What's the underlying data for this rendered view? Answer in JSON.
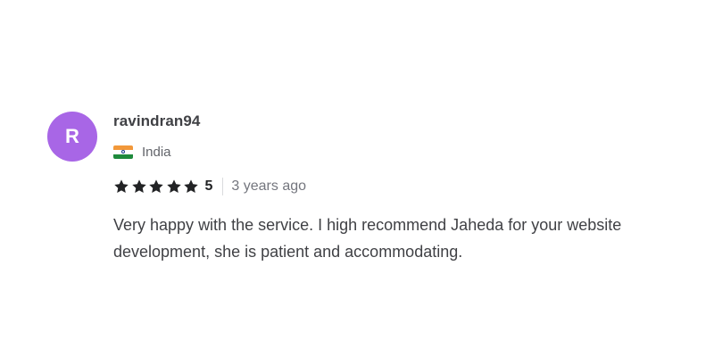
{
  "review": {
    "avatar_letter": "R",
    "username": "ravindran94",
    "country": {
      "name": "India",
      "flag_icon": "india-flag-icon"
    },
    "rating": {
      "stars": 5,
      "value_label": "5",
      "star_icon": "star-icon"
    },
    "time_ago": "3 years ago",
    "text": "Very happy with the service. I high recommend Jaheda for your website development, she is patient and accommodating."
  },
  "colors": {
    "avatar_bg": "#a866e6",
    "username": "#404145",
    "body_text": "#404145",
    "muted_text": "#74767e",
    "star": "#222325"
  }
}
